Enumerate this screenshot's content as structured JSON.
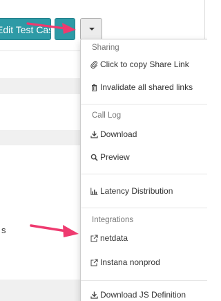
{
  "toolbar": {
    "edit_button_label": "Edit Test Case",
    "colors": {
      "teal": "#2e9aa6",
      "caret_button": "#ececec"
    }
  },
  "background": {
    "partial_text": "s"
  },
  "dropdown": {
    "sections": [
      {
        "header": "Sharing",
        "items": [
          {
            "label": "Click to copy Share Link",
            "icon": "paperclip-icon"
          },
          {
            "label": "Invalidate all shared links",
            "icon": "trash-icon"
          }
        ]
      },
      {
        "header": "Call Log",
        "items": [
          {
            "label": "Download",
            "icon": "download-icon"
          },
          {
            "label": "Preview",
            "icon": "search-icon"
          }
        ]
      },
      {
        "header": "",
        "items": [
          {
            "label": "Latency Distribution",
            "icon": "bar-chart-icon"
          }
        ]
      },
      {
        "header": "Integrations",
        "items": [
          {
            "label": "netdata",
            "icon": "external-link-icon"
          },
          {
            "label": "Instana nonprod",
            "icon": "external-link-icon"
          }
        ]
      },
      {
        "header": "",
        "items": [
          {
            "label": "Download JS Definition",
            "icon": "download-icon"
          }
        ]
      }
    ]
  },
  "annotations": {
    "arrow_color": "#ee3a6f"
  }
}
